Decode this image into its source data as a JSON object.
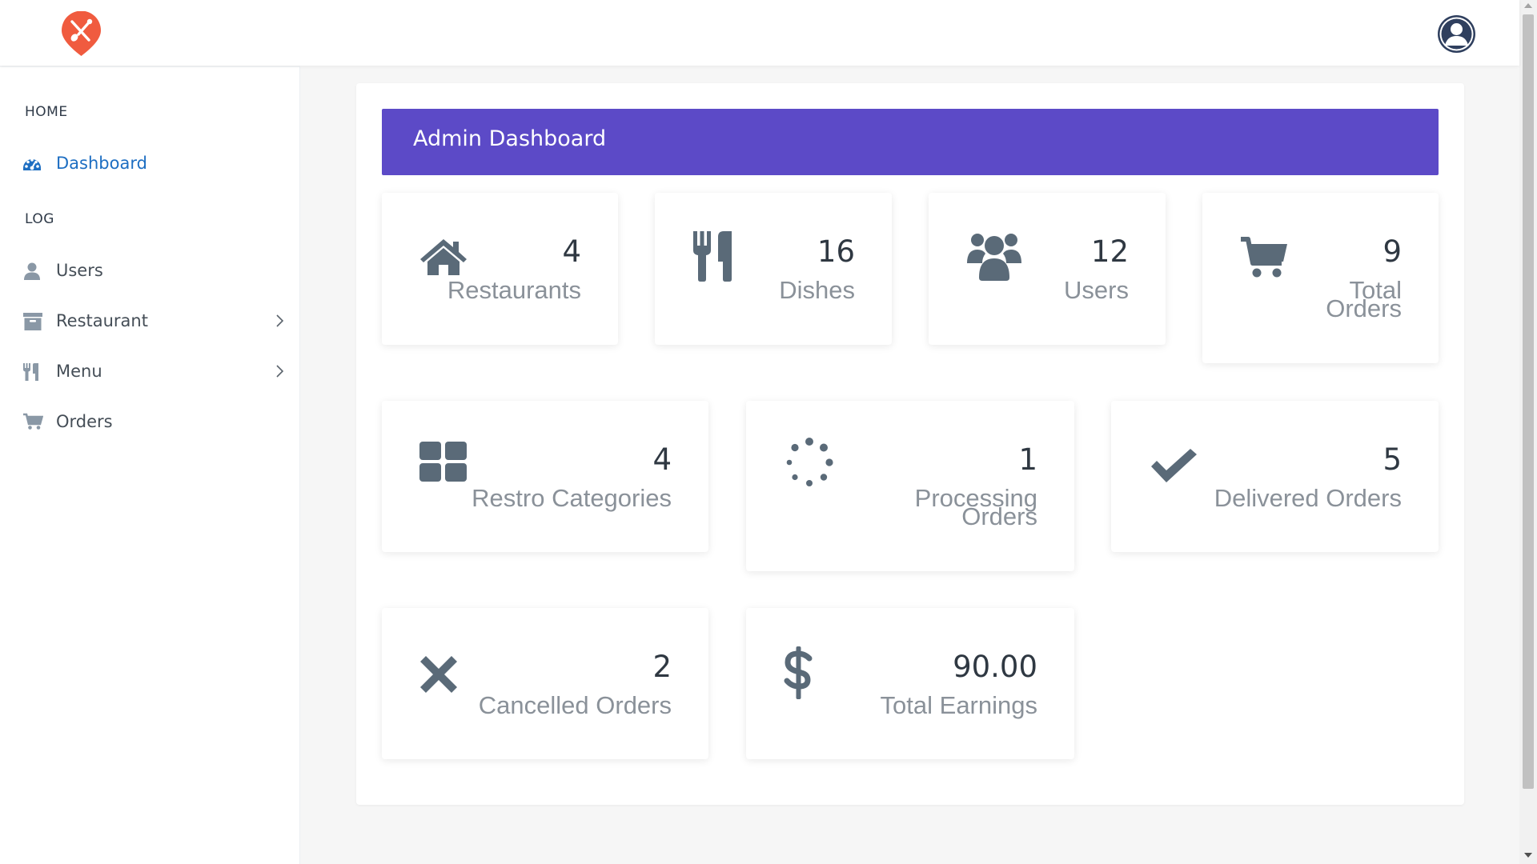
{
  "colors": {
    "header_bg": "#5c4ac7",
    "logo_bg": "#f05b3f",
    "active_link": "#1d6ec2",
    "icon_gray": "#5a6a78"
  },
  "sidebar": {
    "sections": [
      {
        "heading": "HOME"
      },
      {
        "heading": "LOG"
      }
    ],
    "items": [
      {
        "label": "Dashboard",
        "icon": "dashboard-icon",
        "active": true
      },
      {
        "label": "Users",
        "icon": "user-icon"
      },
      {
        "label": "Restaurant",
        "icon": "archive-icon",
        "has_submenu": true
      },
      {
        "label": "Menu",
        "icon": "cutlery-icon",
        "has_submenu": true
      },
      {
        "label": "Orders",
        "icon": "cart-icon"
      }
    ]
  },
  "header": {
    "title": "Admin Dashboard"
  },
  "cards": [
    {
      "value": "4",
      "caption": "Restaurants",
      "icon": "home-icon"
    },
    {
      "value": "16",
      "caption": "Dishes",
      "icon": "cutlery-icon"
    },
    {
      "value": "12",
      "caption": "Users",
      "icon": "users-icon"
    },
    {
      "value": "9",
      "caption": "Total Orders",
      "icon": "cart-icon"
    },
    {
      "value": "4",
      "caption": "Restro Categories",
      "icon": "grid-icon"
    },
    {
      "value": "1",
      "caption": "Processing Orders",
      "icon": "spinner-icon"
    },
    {
      "value": "5",
      "caption": "Delivered Orders",
      "icon": "check-icon"
    },
    {
      "value": "2",
      "caption": "Cancelled Orders",
      "icon": "times-icon"
    },
    {
      "value": "90.00",
      "caption": "Total Earnings",
      "icon": "dollar-icon"
    }
  ]
}
